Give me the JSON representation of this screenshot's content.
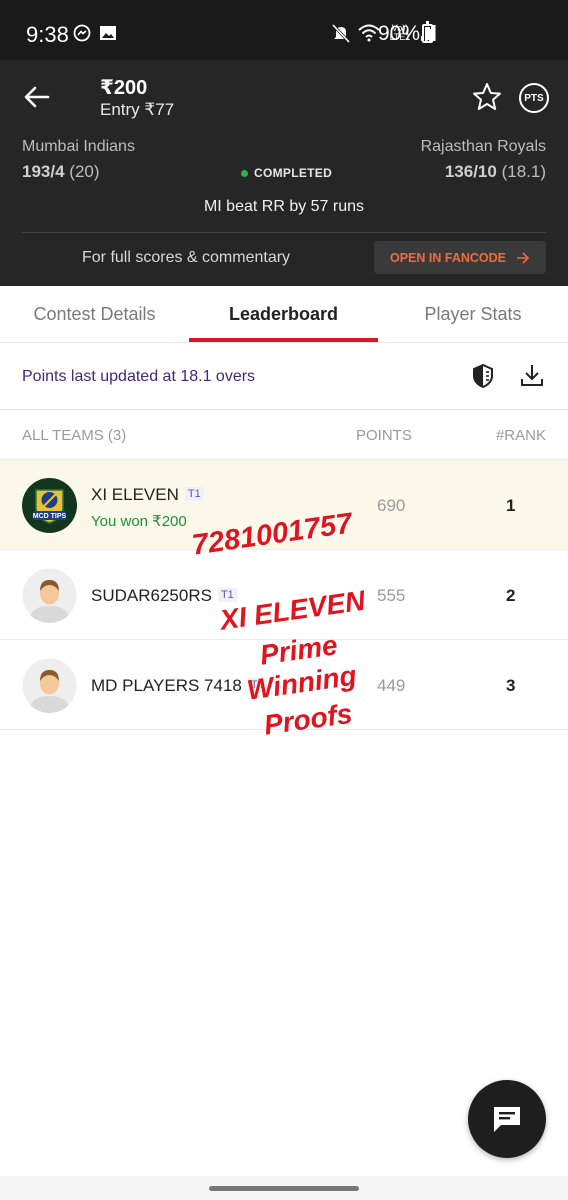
{
  "status_bar": {
    "time": "9:38",
    "battery": "90%",
    "network": "Vo)) LTE1",
    "icons": [
      "messenger-icon",
      "gallery-icon",
      "mute-icon",
      "wifi-icon",
      "signal-icon",
      "battery-icon"
    ]
  },
  "header": {
    "prize": "₹200",
    "entry": "Entry ₹77",
    "pts_label": "PTS",
    "team_left": {
      "name": "Mumbai Indians",
      "score": "193/4",
      "overs": "(20)"
    },
    "team_right": {
      "name": "Rajasthan Royals",
      "score": "136/10",
      "overs": "(18.1)"
    },
    "status": "COMPLETED",
    "status_color": "#2bb24c",
    "result": "MI beat RR by 57 runs",
    "full_scores_text": "For full scores & commentary",
    "fancode_button": "OPEN IN FANCODE"
  },
  "tabs": [
    {
      "label": "Contest Details"
    },
    {
      "label": "Leaderboard"
    },
    {
      "label": "Player Stats"
    }
  ],
  "active_tab": "Leaderboard",
  "accent_color": "#d5182a",
  "points_updated": "Points last updated at 18.1 overs",
  "columns": {
    "teams": "ALL TEAMS (3)",
    "points": "POINTS",
    "rank": "#RANK"
  },
  "rows": [
    {
      "name": "XI ELEVEN",
      "badge": "T1",
      "won": "You won ₹200",
      "points": "690",
      "rank": "1",
      "avatar_text": "MCD TIPS"
    },
    {
      "name": "SUDAR6250RS",
      "badge": "T1",
      "points": "555",
      "rank": "2"
    },
    {
      "name": "MD PLAYERS 7418",
      "badge": "T1",
      "points": "449",
      "rank": "3"
    }
  ],
  "watermark": {
    "phone": "7281001757",
    "lines": [
      "XI ELEVEN",
      "Prime",
      "Winning",
      "Proofs"
    ]
  }
}
